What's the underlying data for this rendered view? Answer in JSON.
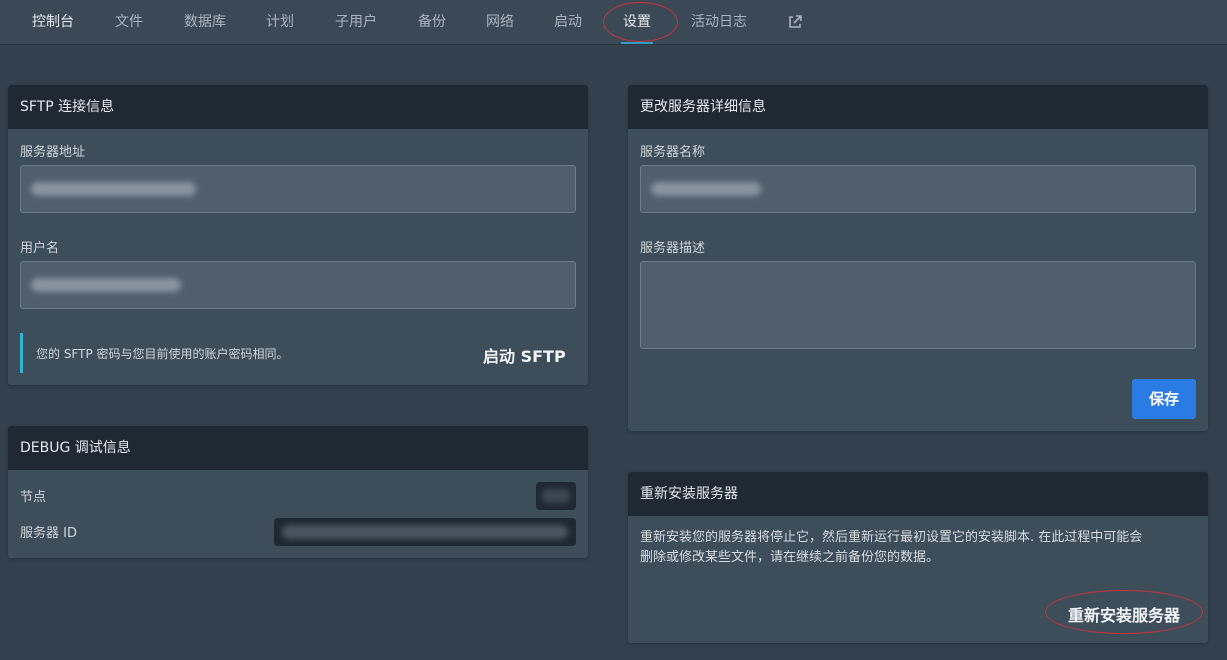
{
  "nav": {
    "items": [
      {
        "label": "控制台"
      },
      {
        "label": "文件"
      },
      {
        "label": "数据库"
      },
      {
        "label": "计划"
      },
      {
        "label": "子用户"
      },
      {
        "label": "备份"
      },
      {
        "label": "网络"
      },
      {
        "label": "启动"
      },
      {
        "label": "设置"
      },
      {
        "label": "活动日志"
      }
    ],
    "external_icon": "external-link-icon"
  },
  "sftp": {
    "title": "SFTP 连接信息",
    "server_address_label": "服务器地址",
    "username_label": "用户名",
    "note": "您的 SFTP 密码与您目前使用的账户密码相同。",
    "launch_label": "启动 SFTP"
  },
  "debug": {
    "title": "DEBUG 调试信息",
    "node_label": "节点",
    "server_id_label": "服务器 ID"
  },
  "details": {
    "title": "更改服务器详细信息",
    "name_label": "服务器名称",
    "desc_label": "服务器描述",
    "save_label": "保存"
  },
  "reinstall": {
    "title": "重新安装服务器",
    "text_line1": "重新安装您的服务器将停止它，然后重新运行最初设置它的安装脚本. 在此过程中可能会",
    "text_line2": "删除或修改某些文件，请在继续之前备份您的数据。",
    "button_label": "重新安装服务器"
  },
  "colors": {
    "accent": "#2b9fc6",
    "save_button": "#2a7be4",
    "annotation": "#c8323a"
  }
}
